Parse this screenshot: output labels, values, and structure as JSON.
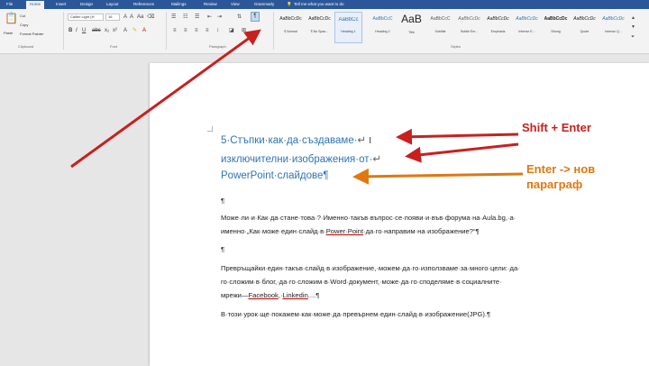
{
  "ribbon_tabs": [
    "File",
    "Home",
    "Insert",
    "Design",
    "Layout",
    "References",
    "Mailings",
    "Review",
    "View",
    "Grammarly"
  ],
  "tell_me": "Tell me what you want to do",
  "clipboard": {
    "paste": "Paste",
    "cut": "Cut",
    "copy": "Copy",
    "format_painter": "Format Painter",
    "label": "Clipboard"
  },
  "font": {
    "name": "Calibri Light (H",
    "size": "16",
    "label": "Font"
  },
  "paragraph": {
    "label": "Paragraph"
  },
  "styles": {
    "label": "Styles",
    "items": [
      {
        "preview": "AaBbCcDc",
        "name": "¶ Normal"
      },
      {
        "preview": "AaBbCcDc",
        "name": "¶ No Spac..."
      },
      {
        "preview": "AaBbCc",
        "name": "Heading 1"
      },
      {
        "preview": "AaBbCcC",
        "name": "Heading 2"
      },
      {
        "preview": "AaB",
        "name": "Title"
      },
      {
        "preview": "AaBbCcC",
        "name": "Subtitle"
      },
      {
        "preview": "AaBbCcDc",
        "name": "Subtle Em..."
      },
      {
        "preview": "AaBbCcDc",
        "name": "Emphasis"
      },
      {
        "preview": "AaBbCcDc",
        "name": "Intense E..."
      },
      {
        "preview": "AaBbCcDc",
        "name": "Strong"
      },
      {
        "preview": "AaBbCcDc",
        "name": "Quote"
      },
      {
        "preview": "AaBbCcDc",
        "name": "Intense Q..."
      }
    ]
  },
  "document": {
    "heading_line1": "5·Стъпки·как·да·създаваме·",
    "heading_break1": "↵",
    "heading_line2": "изключителни·изображения·от·",
    "heading_break2": "↵",
    "heading_line3": "PowerPoint·слайдове¶",
    "empty_para": "¶",
    "p1_l1": "Може·ли·и·Как·да·стане·това·?·Именно·такъв·въпрос·се·появи·и·във·форума·на·Aula.bg,·а·",
    "p1_l2a": "именно·„Как·може·един·слайд·в·",
    "p1_l2_link": "Power·Point",
    "p1_l2b": "·да·го·направим·на·изображение?“¶",
    "p2_l1": "Превръщайки·един·такъв·слайд·в·изображение,·можем·да·го·използваме·за·много·цели:·да·",
    "p2_l2": "го·сложим·в·блог,·да·го·сложим·в·Word·документ,·може·да·го·споделяме·в·социалните·",
    "p2_l3a": "мрежи—",
    "p2_l3_link1": "Facebook",
    "p2_l3_mid": ",·",
    "p2_l3_link2": "Linkedin",
    "p2_l3b": "....¶",
    "p3": "В·този·урок·ще·покажем·как·може·да·превърнем·един·слайд·в·изображение(JPG).¶"
  },
  "annotations": {
    "shift_enter": "Shift + Enter",
    "enter_line1": "Enter -> нов",
    "enter_line2": "параграф"
  },
  "colors": {
    "ribbon_blue": "#2b579a",
    "heading_blue": "#2e74b5",
    "annotation_red": "#c8201e",
    "annotation_orange": "#e07810"
  }
}
